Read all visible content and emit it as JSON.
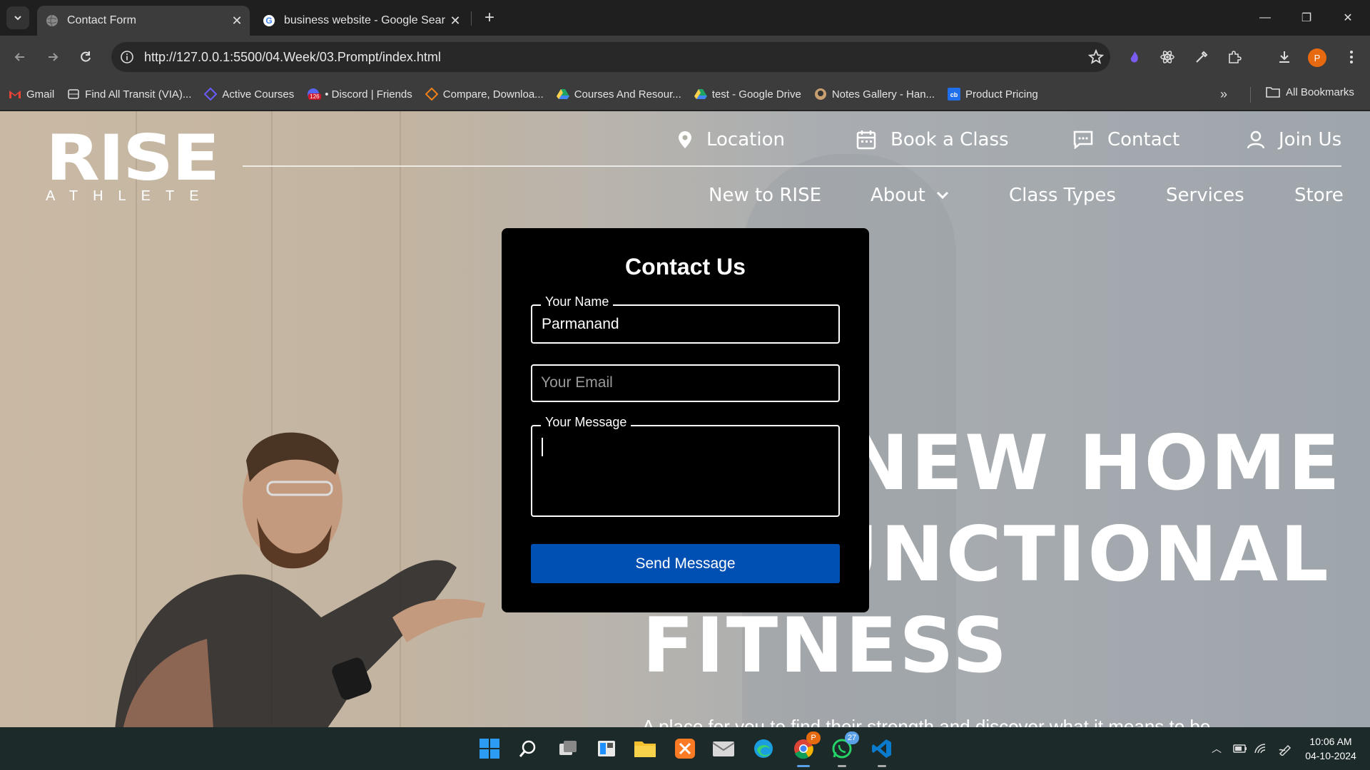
{
  "browser": {
    "tabs": [
      {
        "title": "Contact Form",
        "active": true
      },
      {
        "title": "business website - Google Sear",
        "active": false
      }
    ],
    "url": "http://127.0.0.1:5500/04.Week/03.Prompt/index.html",
    "profile_initial": "P",
    "bookmarks": [
      {
        "label": "Gmail",
        "icon": "gmail-icon"
      },
      {
        "label": "Find All Transit (VIA)...",
        "icon": "transit-icon"
      },
      {
        "label": "Active Courses",
        "icon": "courses-icon"
      },
      {
        "label": "• Discord | Friends",
        "icon": "discord-icon"
      },
      {
        "label": "Compare, Downloa...",
        "icon": "compare-icon"
      },
      {
        "label": "Courses And Resour...",
        "icon": "drive-icon"
      },
      {
        "label": "test - Google Drive",
        "icon": "drive-icon"
      },
      {
        "label": "Notes Gallery - Han...",
        "icon": "notes-icon"
      },
      {
        "label": "Product Pricing",
        "icon": "cb-icon"
      }
    ],
    "all_bookmarks": "All Bookmarks",
    "discord_badge": "126"
  },
  "site": {
    "logo_main": "RISE",
    "logo_sub": "ATHLETE",
    "top_nav": {
      "location": "Location",
      "book": "Book a Class",
      "contact": "Contact",
      "join": "Join Us"
    },
    "main_nav": {
      "new": "New to RISE",
      "about": "About",
      "class_types": "Class Types",
      "services": "Services",
      "store": "Store"
    },
    "hero": {
      "line1": "NEW HOME",
      "line2": "UNCTIONAL",
      "line3": "FITNESS",
      "sub": "A place for you to find their strength and discover what it means to be"
    }
  },
  "form": {
    "title": "Contact Us",
    "name_label": "Your Name",
    "name_value": "Parmanand",
    "email_placeholder": "Your Email",
    "message_label": "Your Message",
    "message_value": "",
    "submit": "Send Message"
  },
  "taskbar": {
    "whatsapp_badge": "27",
    "chrome_badge": "P",
    "time": "10:06 AM",
    "date": "04-10-2024"
  },
  "colors": {
    "submit_button": "#0050b3",
    "profile": "#e86a10"
  }
}
